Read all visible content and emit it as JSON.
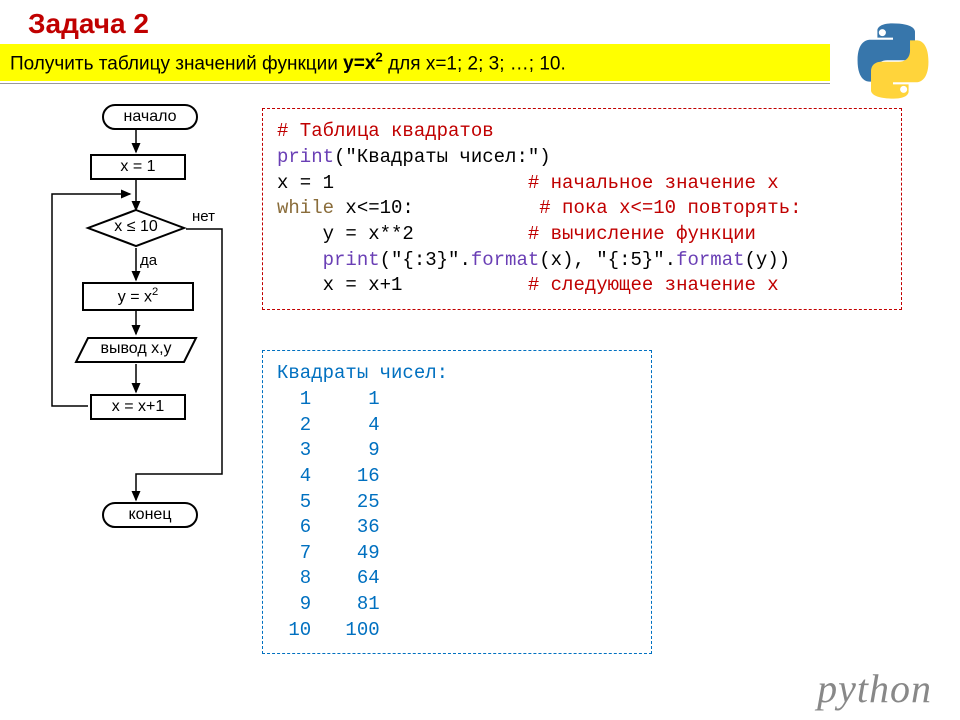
{
  "title": "Задача 2",
  "subtitle_pre": "Получить таблицу значений функции ",
  "subtitle_fn": "y=x",
  "subtitle_sup": "2",
  "subtitle_post": " для x=1; 2; 3; …; 10.",
  "flow": {
    "start": "начало",
    "init": "x = 1",
    "cond": "x ≤ 10",
    "yes": "да",
    "no": "нет",
    "calc_pre": "y = x",
    "calc_sup": "2",
    "out": "вывод x,y",
    "inc": "x = x+1",
    "end": "конец"
  },
  "code": {
    "l1": "# Таблица квадратов",
    "l2a": "print",
    "l2b": "(\"Квадраты чисел:\")",
    "l3a": "x = 1                 ",
    "l3b": "# начальное значение x",
    "l4a": "while",
    "l4b": " x<=10:           ",
    "l4c": "# пока x<=10 повторять:",
    "l5a": "    y = x**2          ",
    "l5b": "# вычисление функции",
    "l6a": "    ",
    "l6b": "print",
    "l6c": "(\"{:3}\".",
    "l6d": "format",
    "l6e": "(x), \"{:5}\".",
    "l6f": "format",
    "l6g": "(y))",
    "l7a": "    x = x+1           ",
    "l7b": "# следующее значение x"
  },
  "output": "Квадраты чисел:\n  1     1\n  2     4\n  3     9\n  4    16\n  5    25\n  6    36\n  7    49\n  8    64\n  9    81\n 10   100",
  "pyword": "python"
}
